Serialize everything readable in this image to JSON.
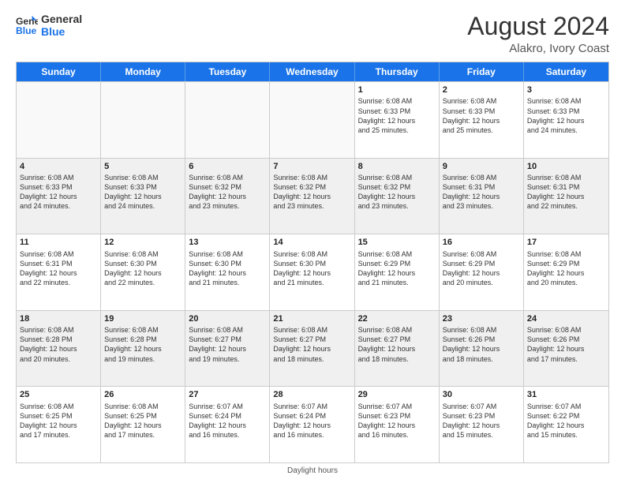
{
  "header": {
    "logo_line1": "General",
    "logo_line2": "Blue",
    "month_year": "August 2024",
    "location": "Alakro, Ivory Coast"
  },
  "days_of_week": [
    "Sunday",
    "Monday",
    "Tuesday",
    "Wednesday",
    "Thursday",
    "Friday",
    "Saturday"
  ],
  "footer": {
    "daylight_label": "Daylight hours"
  },
  "weeks": [
    [
      {
        "day": "",
        "info": "",
        "empty": true
      },
      {
        "day": "",
        "info": "",
        "empty": true
      },
      {
        "day": "",
        "info": "",
        "empty": true
      },
      {
        "day": "",
        "info": "",
        "empty": true
      },
      {
        "day": "1",
        "info": "Sunrise: 6:08 AM\nSunset: 6:33 PM\nDaylight: 12 hours\nand 25 minutes."
      },
      {
        "day": "2",
        "info": "Sunrise: 6:08 AM\nSunset: 6:33 PM\nDaylight: 12 hours\nand 25 minutes."
      },
      {
        "day": "3",
        "info": "Sunrise: 6:08 AM\nSunset: 6:33 PM\nDaylight: 12 hours\nand 24 minutes."
      }
    ],
    [
      {
        "day": "4",
        "info": "Sunrise: 6:08 AM\nSunset: 6:33 PM\nDaylight: 12 hours\nand 24 minutes."
      },
      {
        "day": "5",
        "info": "Sunrise: 6:08 AM\nSunset: 6:33 PM\nDaylight: 12 hours\nand 24 minutes."
      },
      {
        "day": "6",
        "info": "Sunrise: 6:08 AM\nSunset: 6:32 PM\nDaylight: 12 hours\nand 23 minutes."
      },
      {
        "day": "7",
        "info": "Sunrise: 6:08 AM\nSunset: 6:32 PM\nDaylight: 12 hours\nand 23 minutes."
      },
      {
        "day": "8",
        "info": "Sunrise: 6:08 AM\nSunset: 6:32 PM\nDaylight: 12 hours\nand 23 minutes."
      },
      {
        "day": "9",
        "info": "Sunrise: 6:08 AM\nSunset: 6:31 PM\nDaylight: 12 hours\nand 23 minutes."
      },
      {
        "day": "10",
        "info": "Sunrise: 6:08 AM\nSunset: 6:31 PM\nDaylight: 12 hours\nand 22 minutes."
      }
    ],
    [
      {
        "day": "11",
        "info": "Sunrise: 6:08 AM\nSunset: 6:31 PM\nDaylight: 12 hours\nand 22 minutes."
      },
      {
        "day": "12",
        "info": "Sunrise: 6:08 AM\nSunset: 6:30 PM\nDaylight: 12 hours\nand 22 minutes."
      },
      {
        "day": "13",
        "info": "Sunrise: 6:08 AM\nSunset: 6:30 PM\nDaylight: 12 hours\nand 21 minutes."
      },
      {
        "day": "14",
        "info": "Sunrise: 6:08 AM\nSunset: 6:30 PM\nDaylight: 12 hours\nand 21 minutes."
      },
      {
        "day": "15",
        "info": "Sunrise: 6:08 AM\nSunset: 6:29 PM\nDaylight: 12 hours\nand 21 minutes."
      },
      {
        "day": "16",
        "info": "Sunrise: 6:08 AM\nSunset: 6:29 PM\nDaylight: 12 hours\nand 20 minutes."
      },
      {
        "day": "17",
        "info": "Sunrise: 6:08 AM\nSunset: 6:29 PM\nDaylight: 12 hours\nand 20 minutes."
      }
    ],
    [
      {
        "day": "18",
        "info": "Sunrise: 6:08 AM\nSunset: 6:28 PM\nDaylight: 12 hours\nand 20 minutes."
      },
      {
        "day": "19",
        "info": "Sunrise: 6:08 AM\nSunset: 6:28 PM\nDaylight: 12 hours\nand 19 minutes."
      },
      {
        "day": "20",
        "info": "Sunrise: 6:08 AM\nSunset: 6:27 PM\nDaylight: 12 hours\nand 19 minutes."
      },
      {
        "day": "21",
        "info": "Sunrise: 6:08 AM\nSunset: 6:27 PM\nDaylight: 12 hours\nand 18 minutes."
      },
      {
        "day": "22",
        "info": "Sunrise: 6:08 AM\nSunset: 6:27 PM\nDaylight: 12 hours\nand 18 minutes."
      },
      {
        "day": "23",
        "info": "Sunrise: 6:08 AM\nSunset: 6:26 PM\nDaylight: 12 hours\nand 18 minutes."
      },
      {
        "day": "24",
        "info": "Sunrise: 6:08 AM\nSunset: 6:26 PM\nDaylight: 12 hours\nand 17 minutes."
      }
    ],
    [
      {
        "day": "25",
        "info": "Sunrise: 6:08 AM\nSunset: 6:25 PM\nDaylight: 12 hours\nand 17 minutes."
      },
      {
        "day": "26",
        "info": "Sunrise: 6:08 AM\nSunset: 6:25 PM\nDaylight: 12 hours\nand 17 minutes."
      },
      {
        "day": "27",
        "info": "Sunrise: 6:07 AM\nSunset: 6:24 PM\nDaylight: 12 hours\nand 16 minutes."
      },
      {
        "day": "28",
        "info": "Sunrise: 6:07 AM\nSunset: 6:24 PM\nDaylight: 12 hours\nand 16 minutes."
      },
      {
        "day": "29",
        "info": "Sunrise: 6:07 AM\nSunset: 6:23 PM\nDaylight: 12 hours\nand 16 minutes."
      },
      {
        "day": "30",
        "info": "Sunrise: 6:07 AM\nSunset: 6:23 PM\nDaylight: 12 hours\nand 15 minutes."
      },
      {
        "day": "31",
        "info": "Sunrise: 6:07 AM\nSunset: 6:22 PM\nDaylight: 12 hours\nand 15 minutes."
      }
    ]
  ]
}
